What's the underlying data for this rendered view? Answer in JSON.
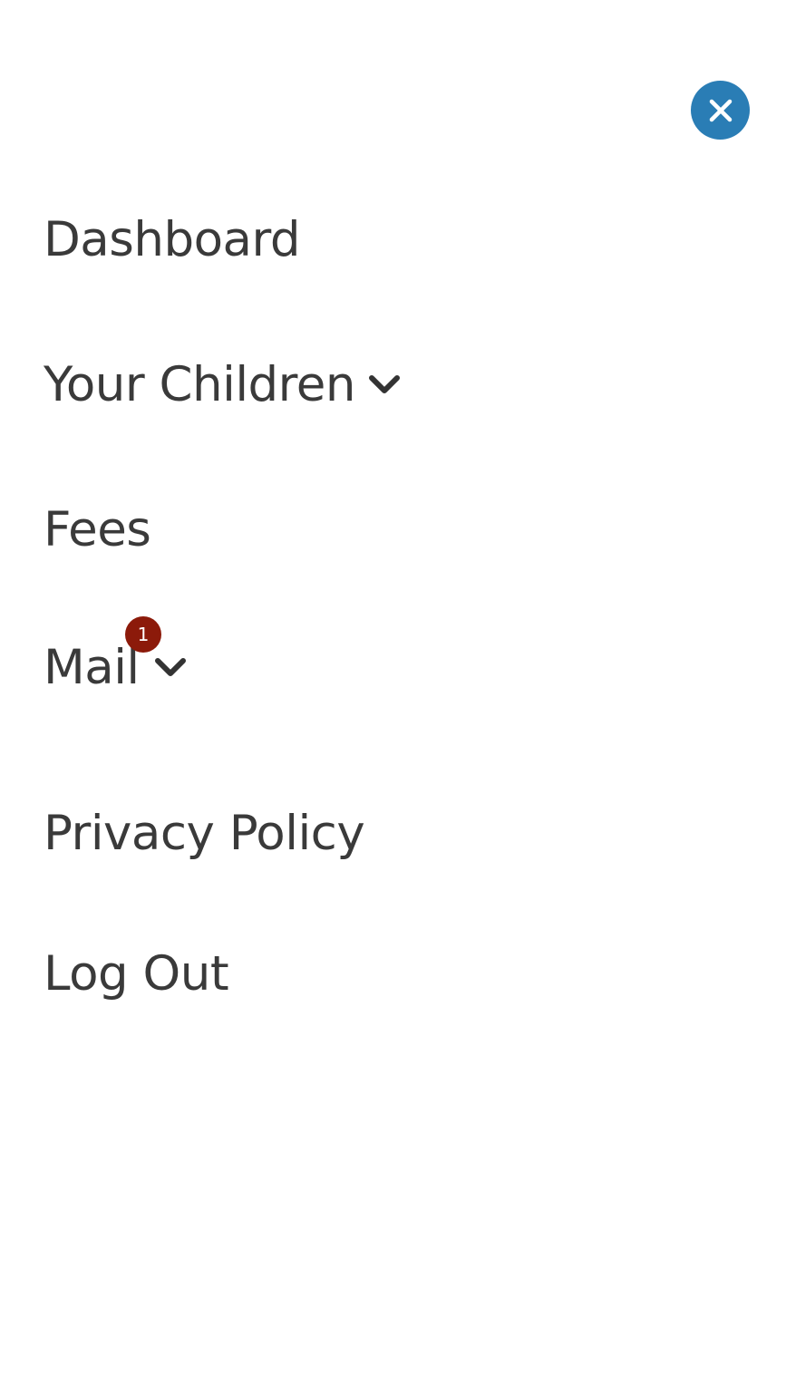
{
  "close": {
    "icon": "close-icon",
    "color": "#2a7db5"
  },
  "nav": {
    "items": [
      {
        "label": "Dashboard"
      },
      {
        "label": "Your Children",
        "icon": "chevron-down-icon"
      },
      {
        "label": "Fees"
      },
      {
        "label": "Mail",
        "icon": "chevron-down-icon",
        "badge": "1",
        "badge_color": "#8c1a0a"
      },
      {
        "label": "Privacy Policy"
      },
      {
        "label": "Log Out"
      }
    ]
  }
}
